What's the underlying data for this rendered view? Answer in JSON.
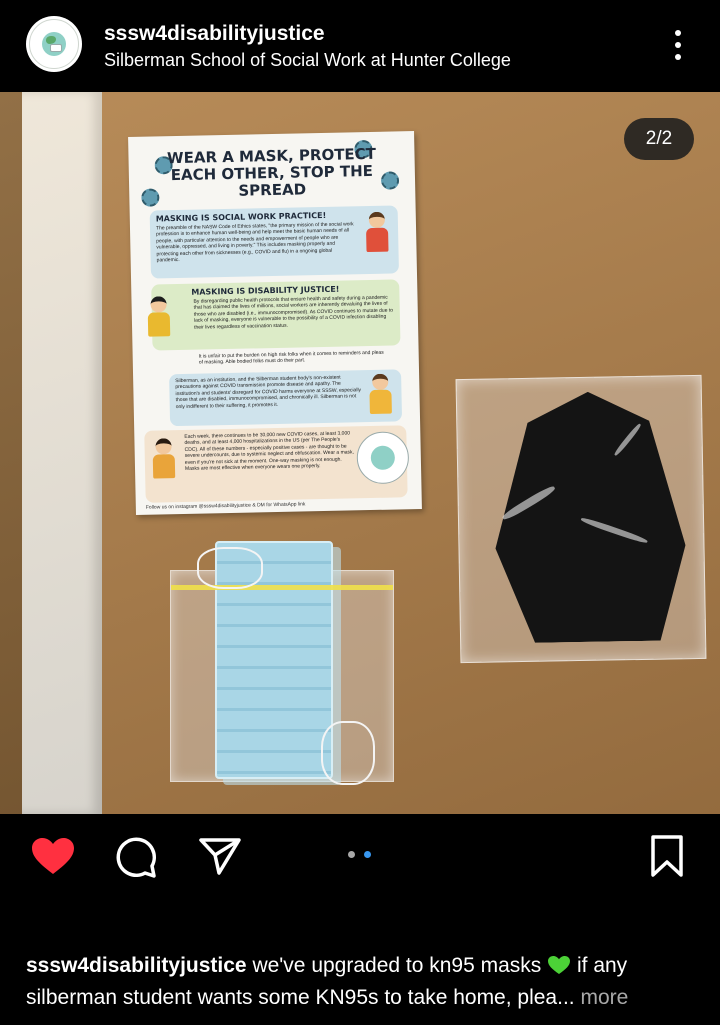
{
  "header": {
    "username": "sssw4disabilityjustice",
    "subtitle": "Silberman School of Social Work at Hunter College",
    "avatar_icon": "profile-logo-icon",
    "menu_icon": "more-vertical-icon"
  },
  "post": {
    "counter": "2/2",
    "poster": {
      "title": "WEAR A MASK, PROTECT EACH OTHER, STOP THE SPREAD",
      "sections": [
        {
          "heading": "MASKING IS SOCIAL WORK PRACTICE!",
          "body": "The preamble of the NASW Code of Ethics states, \"the primary mission of the social work profession is to enhance human well-being and help meet the basic human needs of all people, with particular attention to the needs and empowerment of people who are vulnerable, oppressed, and living in poverty.\" This includes masking properly and protecting each other from sicknesses (e.g., COVID and flu) in a ongoing global pandemic."
        },
        {
          "heading": "MASKING IS DISABILITY JUSTICE!",
          "body": "By disregarding public health protocols that ensure health and safety during a pandemic that has claimed the lives of millions, social workers are inherently devaluing the lives of those who are disabled (i.e., immunocompromised). As COVID continues to mutate due to lack of masking, everyone is vulnerable to the possibility of a COVID infection disabling their lives regardless of vaccination status."
        },
        {
          "heading": "",
          "body": "It is unfair to put the burden on high risk folks when it comes to reminders and pleas of masking. Able bodied folks must do their part."
        },
        {
          "heading": "",
          "body": "Silberman, as an institution, and the Silberman student body's non-existent precautions against COVID transmission promote disease and apathy. The institution's and students' disregard for COVID harms everyone at SSSW, especially those that are disabled, immunocompromised, and chronically ill. Silberman is not only indifferent to their suffering, it promotes it."
        },
        {
          "heading": "",
          "body": "Each week, there continues to be 30,000 new COVID cases, at least 3,000 deaths, and at least 4,000 hospitalizations in the US (per The People's CDC). All of these numbers - especially positive cases - are thought to be severe undercounts, due to systemic neglect and obfuscation. Wear a mask, even if you're not sick at the moment. One-way masking is not enough. Masks are most effective when everyone wears one properly."
        }
      ],
      "footer": "Follow us on instagram @sssw4disabilityjustice & DM for WhatsApp link"
    }
  },
  "actions": {
    "like_icon": "heart-filled-icon",
    "comment_icon": "comment-icon",
    "share_icon": "send-icon",
    "save_icon": "bookmark-icon",
    "like_color": "#ff3040",
    "active_dot_color": "#3897f0",
    "inactive_dot_color": "#a8a8a8",
    "carousel_total": 2,
    "carousel_active": 2
  },
  "caption": {
    "username": "sssw4disabilityjustice",
    "text_before_emoji": "we've upgraded to kn95 masks",
    "emoji_icon": "green-heart-icon",
    "text_after_emoji": "if any silberman student wants some KN95s to take home, plea",
    "ellipsis": "...",
    "more_label": "more"
  }
}
